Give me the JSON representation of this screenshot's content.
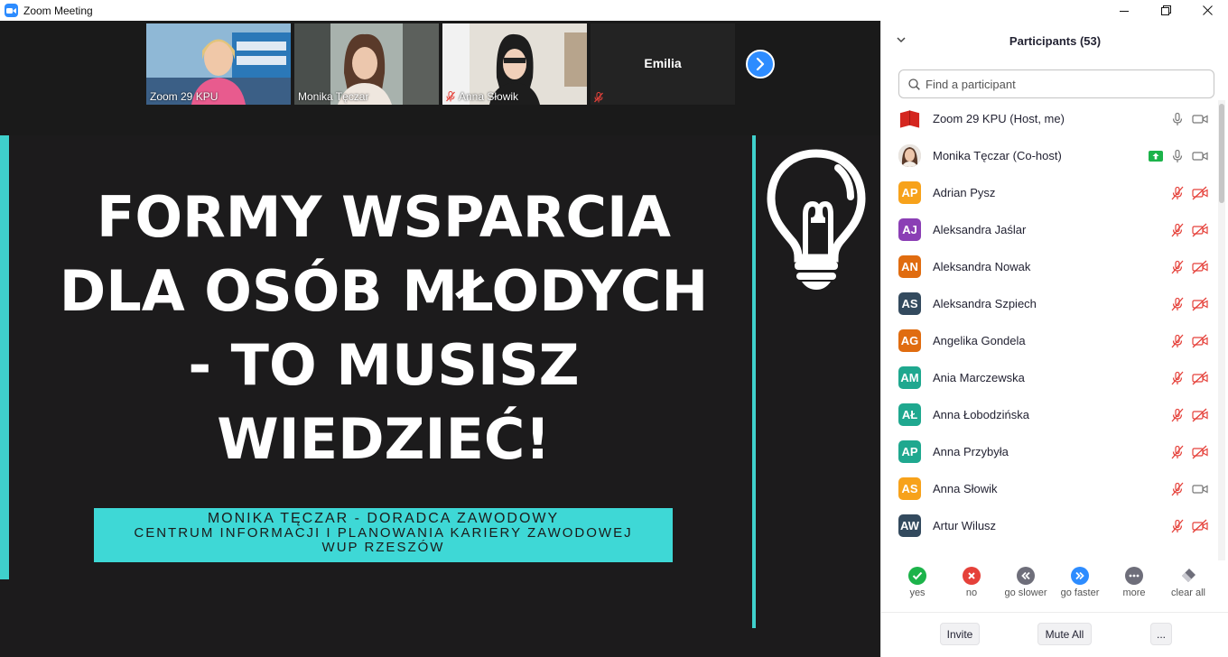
{
  "window": {
    "title": "Zoom Meeting"
  },
  "thumbnails": [
    {
      "name": "Zoom 29 KPU",
      "muted": false
    },
    {
      "name": "Monika Tęczar",
      "muted": false
    },
    {
      "name": "Anna Słowik",
      "muted": true
    },
    {
      "name": "Emilia",
      "muted": true,
      "video": false
    }
  ],
  "slide": {
    "title_lines": [
      "FORMY WSPARCIA",
      "DLA OSÓB MŁODYCH",
      "- TO MUSISZ",
      "WIEDZIEĆ!"
    ],
    "subtitle_lines": [
      "MONIKA TĘCZAR - DORADCA ZAWODOWY",
      "CENTRUM INFORMACJI I PLANOWANIA KARIERY ZAWODOWEJ",
      "WUP RZESZÓW"
    ],
    "accent_color": "#3ed8d6"
  },
  "participants_panel": {
    "title": "Participants (53)",
    "search_placeholder": "Find a participant",
    "participants": [
      {
        "name": "Zoom 29 KPU (Host, me)",
        "initials": "",
        "avatar": "logo",
        "mic": "on",
        "video": "on"
      },
      {
        "name": "Monika Tęczar (Co-host)",
        "initials": "",
        "avatar": "photo",
        "mic": "on",
        "video": "on",
        "sharing": true
      },
      {
        "name": "Adrian Pysz",
        "initials": "AP",
        "color": "#f7a21b",
        "mic": "off",
        "video": "off"
      },
      {
        "name": "Aleksandra Jaślar",
        "initials": "AJ",
        "color": "#8b3fb5",
        "mic": "off",
        "video": "off"
      },
      {
        "name": "Aleksandra Nowak",
        "initials": "AN",
        "color": "#e06c10",
        "mic": "off",
        "video": "off"
      },
      {
        "name": "Aleksandra Szpiech",
        "initials": "AS",
        "color": "#334a5e",
        "mic": "off",
        "video": "off"
      },
      {
        "name": "Angelika Gondela",
        "initials": "AG",
        "color": "#e06c10",
        "mic": "off",
        "video": "off"
      },
      {
        "name": "Ania Marczewska",
        "initials": "AM",
        "color": "#1fa88f",
        "mic": "off",
        "video": "off"
      },
      {
        "name": "Anna Łobodzińska",
        "initials": "AŁ",
        "color": "#1fa88f",
        "mic": "off",
        "video": "off"
      },
      {
        "name": "Anna Przybyła",
        "initials": "AP",
        "color": "#1fa88f",
        "mic": "off",
        "video": "off"
      },
      {
        "name": "Anna Słowik",
        "initials": "AS",
        "color": "#f7a21b",
        "mic": "off",
        "video": "on"
      },
      {
        "name": "Artur Wilusz",
        "initials": "AW",
        "color": "#334a5e",
        "mic": "off",
        "video": "off"
      }
    ],
    "reactions": [
      {
        "label": "yes",
        "color": "#1cb34a",
        "icon": "check-icon"
      },
      {
        "label": "no",
        "color": "#e5413a",
        "icon": "x-icon"
      },
      {
        "label": "go slower",
        "color": "#6e6e7a",
        "icon": "rewind-icon"
      },
      {
        "label": "go faster",
        "color": "#2d8cff",
        "icon": "fast-forward-icon"
      },
      {
        "label": "more",
        "color": "#6e6e7a",
        "icon": "more-icon"
      },
      {
        "label": "clear all",
        "color": "#6e6e7a",
        "icon": "eraser-icon"
      }
    ],
    "buttons": {
      "invite": "Invite",
      "mute_all": "Mute All",
      "more": "..."
    }
  }
}
